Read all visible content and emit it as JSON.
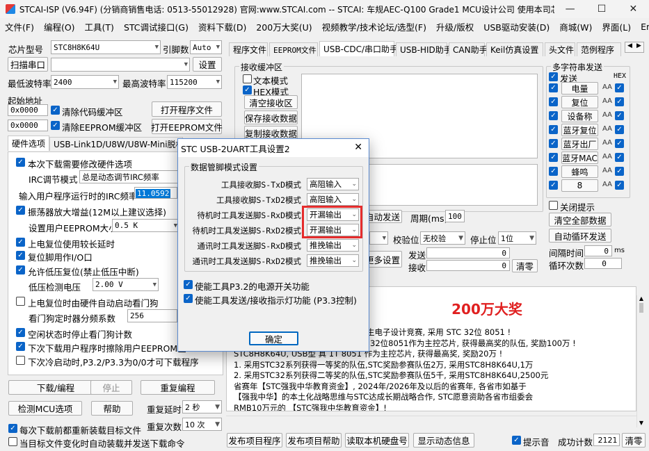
{
  "window": {
    "title": "STCAI-ISP (V6.94F) (分销商销售电话: 0513-55012928) 官网:www.STCAI.com  -- STCAI: 车规AEC-Q100 Grade1 MCU设计公司 使用本司芯片或采...",
    "min": "—",
    "max": "☐",
    "close": "✕"
  },
  "menu": [
    "文件(F)",
    "编程(O)",
    "工具(T)",
    "STC调试接口(G)",
    "资料下载(D)",
    "200万大奖(U)",
    "视频教学/技术论坛/选型(F)",
    "升级/版权",
    "USB驱动安装(D)",
    "商城(W)",
    "界面(L)",
    "English"
  ],
  "left": {
    "chip_label": "芯片型号",
    "chip_value": "STC8H8K64U",
    "pin_label": "引脚数",
    "pin_value": "Auto",
    "scan_label": "扫描串口",
    "settings_label": "设置",
    "min_baud_label": "最低波特率",
    "min_baud_value": "2400",
    "max_baud_label": "最高波特率",
    "max_baud_value": "115200",
    "start_addr_label": "起始地址",
    "addr1": "0x0000",
    "clear_code": "清除代码缓冲区",
    "open_prog": "打开程序文件",
    "addr2": "0x0000",
    "clear_eeprom": "清除EEPROM缓冲区",
    "open_eeprom": "打开EEPROM文件",
    "tabs": [
      "硬件选项",
      "USB-Link1D/U8W/U8W-Mini脱机"
    ],
    "hw": {
      "opt1": "本次下载需要修改硬件选项",
      "irc_mode_label": "IRC调节模式",
      "irc_mode_value": "总是动态调节IRC频率",
      "irc_freq_label": "输入用户程序运行时的IRC频率",
      "irc_freq_value": "11.0592",
      "opt2": "振荡器放大增益(12M以上建议选择)",
      "eeprom_size_label": "设置用户EEPROM大小",
      "eeprom_size_value": "0.5 K",
      "opt3": "上电复位使用较长延时",
      "opt4": "复位脚用作I/O口",
      "opt5": "允许低压复位(禁止低压中断)",
      "lv_label": "低压检测电压",
      "lv_value": "2.00 V",
      "opt6": "上电复位时由硬件自动启动看门狗",
      "wdt_label": "看门狗定时器分频系数",
      "wdt_value": "256",
      "opt7": "空闲状态时停止看门狗计数",
      "opt8": "下次下载用户程序时擦除用户EEPROM区",
      "opt9": "下次冷启动时,P3.2/P3.3为0/0才可下载程序"
    },
    "download": "下载/编程",
    "stop": "停止",
    "reprogram": "重复编程",
    "detect": "检测MCU选项",
    "help": "帮助",
    "repeat_delay_label": "重复延时",
    "repeat_delay_value": "2 秒",
    "repeat_count_label": "重复次数",
    "repeat_count_value": "10 次",
    "reload_label": "每次下载前都重新装载目标文件",
    "auto_label": "当目标文件变化时自动装载并发送下载命令"
  },
  "right": {
    "tabs": [
      "程序文件",
      "EEPROM文件",
      "USB-CDC/串口助手",
      "USB-HID助手",
      "CAN助手",
      "Keil仿真设置",
      "头文件",
      "范例程序"
    ],
    "recv_group": "接收缓冲区",
    "text_mode": "文本模式",
    "hex_mode": "HEX模式",
    "clear_recv": "清空接收区",
    "save_recv": "保存接收数据",
    "copy_recv": "复制接收数据",
    "multi_title": "多字符串发送",
    "send_col": "发送",
    "hex_col": "HEX",
    "multi_items": [
      "电量",
      "复位",
      "设备称",
      "蓝牙复位",
      "蓝牙出厂",
      "蓝牙MAC",
      "蜂鸣",
      "8"
    ],
    "aa": "AA",
    "close_tip": "关闭提示",
    "clear_all": "清空全部数据",
    "auto_loop": "自动循环发送",
    "interval_label": "间隔时间",
    "interval_value": "0",
    "interval_unit": "ms",
    "loop_label": "循环次数",
    "loop_value": "0",
    "auto_send": "自动发送",
    "period_label": "周期(ms)",
    "period_value": "100",
    "parity_label": "校验位",
    "parity_value": "无校验",
    "stop_label": "停止位",
    "stop_value": "1位",
    "more": "更多设置",
    "send_label": "发送",
    "send_count": "0",
    "recv_label": "接收",
    "recv_count": "0",
    "clear_count": "清零",
    "prize_title": "200万大奖",
    "prize_lines": [
      "大学生电子设计竞赛, 采用 STC 32位 8051 !",
      "32位8051作为主控芯片, 获得最高奖的队伍, 奖励100万 !",
      "STC8H8K64U, USB型 真 1T 8051 作为主控芯片, 获得最高奖, 奖励20万 !",
      "1. 采用STC32系列获得一等奖的队伍,STC奖励参赛队伍2万, 采用STC8H8K64U,1万",
      "2. 采用STC32系列获得二等奖的队伍,STC奖励参赛队伍5千, 采用STC8H8K64U,2500元",
      "省赛年【STC强我中华教育资金】, 2024年/2026年及以后的省赛年, 各省市如基于",
      "【强我中华】的本土化战略思维与STC达成长期战略合作, STC愿意资助各省市组委会",
      "RMB10万元的 【STC强我中华教育资金】!"
    ],
    "bottom": [
      "发布项目程序",
      "发布项目帮助",
      "读取本机硬盘号",
      "显示动态信息"
    ],
    "sound": "提示音",
    "success_label": "成功计数",
    "success_value": "2121",
    "clear": "清零"
  },
  "dialog": {
    "title": "STC USB-2UART工具设置2",
    "group": "数据管脚模式设置",
    "rows": [
      {
        "label": "工具接收脚S-TxD模式",
        "value": "高阻输入"
      },
      {
        "label": "工具接收脚S-TxD2模式",
        "value": "高阻输入"
      },
      {
        "label": "待机时工具发送脚S-RxD模式",
        "value": "开漏输出"
      },
      {
        "label": "待机时工具发送脚S-RxD2模式",
        "value": "开漏输出"
      },
      {
        "label": "通讯时工具发送脚S-RxD模式",
        "value": "推挽输出"
      },
      {
        "label": "通讯时工具发送脚S-RxD2模式",
        "value": "推挽输出"
      }
    ],
    "opt1": "使能工具P3.2的电源开关功能",
    "opt2": "使能工具发送/接收指示灯功能 (P3.3控制)",
    "ok": "确定"
  },
  "colors": {
    "accent": "#0a64c8",
    "highlight": "#e52c2c",
    "prize": "#e02020",
    "freq_bg": "#0078d7"
  }
}
